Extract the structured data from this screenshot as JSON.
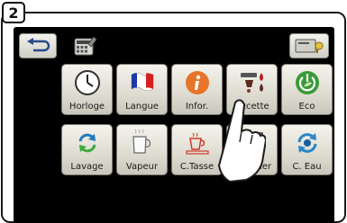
{
  "step": {
    "number": "2"
  },
  "toolbar": {
    "back_icon": "back-arrow-icon",
    "settings_icon": "calculator-wrench-icon",
    "right_icon": "card-key-icon"
  },
  "tiles": {
    "horloge": {
      "label": "Horloge",
      "icon": "clock-icon"
    },
    "langue": {
      "label": "Langue",
      "icon": "flag-icon"
    },
    "infor": {
      "label": "Infor.",
      "icon": "info-icon"
    },
    "recette": {
      "label": "Recette",
      "icon": "cup-drops-icon"
    },
    "eco": {
      "label": "Eco",
      "icon": "power-leaf-icon"
    },
    "lavage": {
      "label": "Lavage",
      "icon": "refresh-icon"
    },
    "vapeur": {
      "label": "Vapeur",
      "icon": "milk-jug-icon"
    },
    "ctasse": {
      "label": "C.Tasse",
      "icon": "cup-heater-icon"
    },
    "boiler": {
      "label": "Boiler",
      "icon": "boiler-drip-icon"
    },
    "ceau": {
      "label": "C. Eau",
      "icon": "water-cycle-icon"
    }
  },
  "colors": {
    "screen": "#000000",
    "tile": "#e8e6dc",
    "accent_orange": "#e8742a",
    "accent_green": "#3a9a3a"
  }
}
